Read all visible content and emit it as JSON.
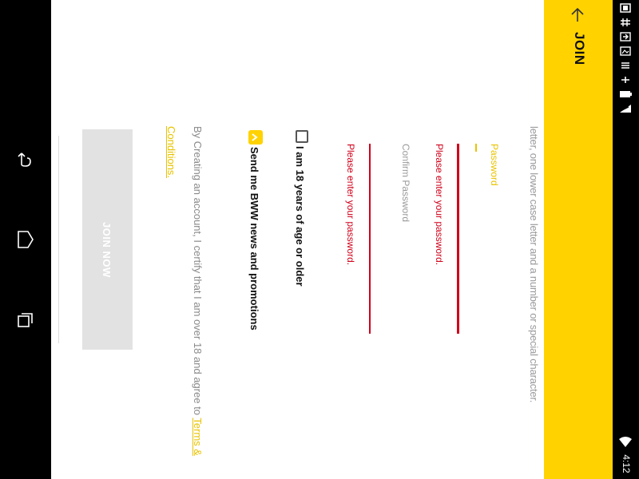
{
  "header": {
    "title": "JOIN",
    "accent_color": "#ffd200"
  },
  "form": {
    "password_hint": "letter, one lower case letter and a number or special character.",
    "password": {
      "label": "Password",
      "error": "Please enter your password."
    },
    "confirm_password": {
      "placeholder": "Confirm Password",
      "error": "Please enter your password."
    },
    "age_checkbox": {
      "label": "I am 18 years of age or older",
      "checked": false
    },
    "newsletter_checkbox": {
      "label": "Send me BWW news and promotions",
      "checked": true
    },
    "terms": {
      "text": "By Creating an account, I certify that I am over 18 and agree to ",
      "link_part1": "Terms &",
      "link_part2": "Conditions."
    },
    "join_button": "JOIN NOW"
  },
  "status_bar": {
    "time": "4:12"
  },
  "nav_bar": {
    "buttons": [
      "back",
      "home",
      "recents"
    ]
  },
  "colors": {
    "error": "#d0021b",
    "accent": "#ffd200",
    "disabled_button": "#e2e2e2"
  }
}
